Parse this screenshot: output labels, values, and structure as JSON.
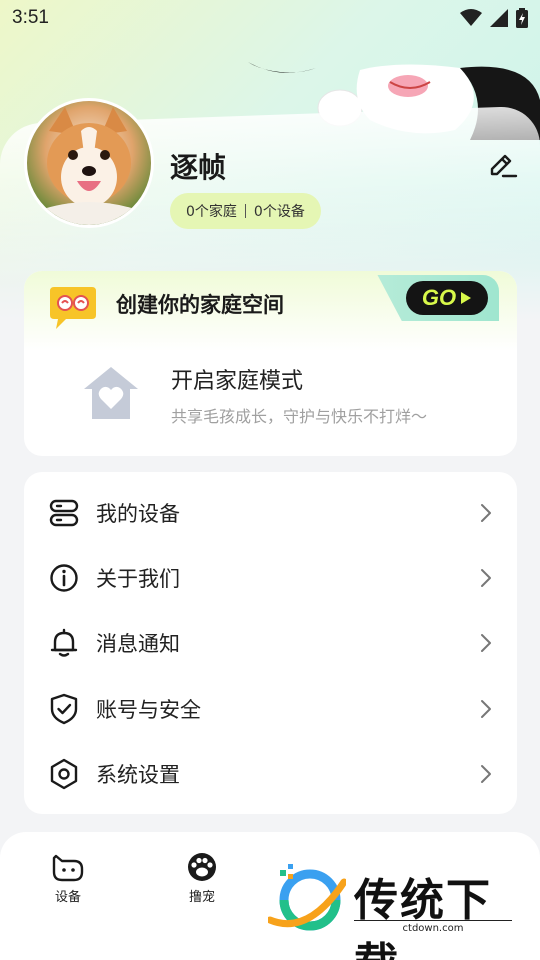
{
  "status_bar": {
    "time": "3:51"
  },
  "profile": {
    "username": "逐帧",
    "family_count": "0个家庭",
    "device_count": "0个设备"
  },
  "family_card": {
    "banner_title": "创建你的家庭空间",
    "go_label": "GO",
    "mode_title": "开启家庭模式",
    "mode_subtitle": "共享毛孩成长，守护与快乐不打烊～"
  },
  "menu": {
    "items": [
      {
        "label": "我的设备",
        "icon": "device-icon"
      },
      {
        "label": "关于我们",
        "icon": "info-icon"
      },
      {
        "label": "消息通知",
        "icon": "bell-icon"
      },
      {
        "label": "账号与安全",
        "icon": "shield-check-icon"
      },
      {
        "label": "系统设置",
        "icon": "settings-hexagon-icon"
      }
    ]
  },
  "bottom_nav": {
    "items": [
      {
        "label": "设备",
        "icon": "device-cat-icon"
      },
      {
        "label": "撸宠",
        "icon": "paw-icon"
      }
    ]
  },
  "watermark": {
    "brand": "传统下载",
    "url": "ctdown.com"
  },
  "colors": {
    "accent_lime": "#d8f84a",
    "pill_bg": "#e5f6b4",
    "go_bg": "#141414",
    "header_gradient_start": "#eef7c8",
    "header_gradient_end": "#c9f3ec"
  }
}
